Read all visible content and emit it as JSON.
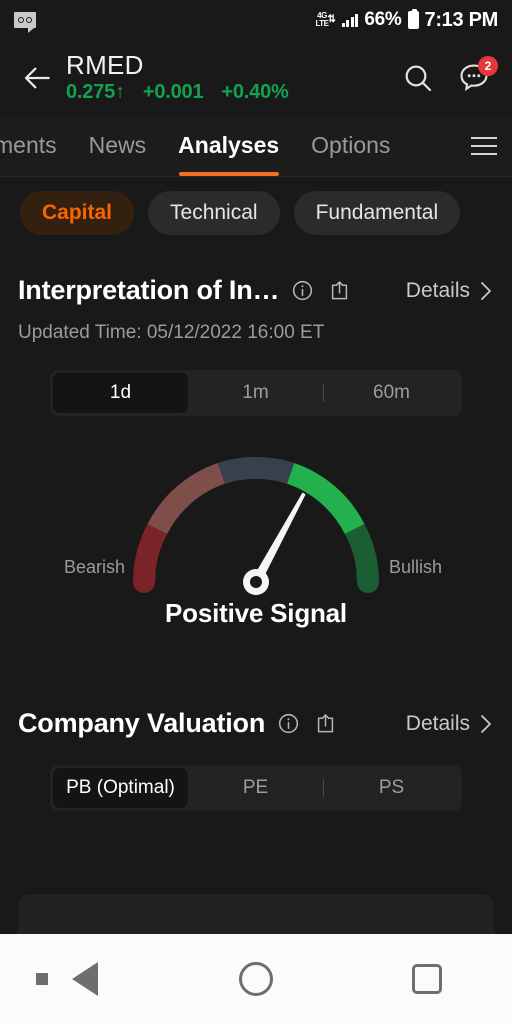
{
  "status_bar": {
    "voicemail_icon": "voicemail-icon",
    "network_label_top": "4G",
    "network_label_bottom": "LTE",
    "network_arrows": "⇅",
    "signal_icon": "signal-bars-icon",
    "battery_percent": "66%",
    "battery_icon": "battery-icon",
    "time": "7:13 PM"
  },
  "header": {
    "back_icon": "back-arrow-icon",
    "symbol": "RMED",
    "price": "0.275",
    "price_arrow": "↑",
    "change": "+0.001",
    "change_percent": "+0.40%",
    "up_color": "#12a150",
    "search_icon": "search-icon",
    "chat_icon": "chat-bubble-icon",
    "chat_badge": "2",
    "badge_color": "#e4393c"
  },
  "nav_tabs": {
    "accent_color": "#f26f21",
    "items": [
      {
        "label": "ments",
        "active": false,
        "clipped": true
      },
      {
        "label": "News",
        "active": false
      },
      {
        "label": "Analyses",
        "active": true
      },
      {
        "label": "Options",
        "active": false
      }
    ],
    "menu_icon": "hamburger-menu-icon"
  },
  "chips": [
    {
      "label": "Capital",
      "active": true
    },
    {
      "label": "Technical",
      "active": false
    },
    {
      "label": "Fundamental",
      "active": false
    }
  ],
  "interpretation": {
    "title": "Interpretation of In…",
    "info_icon": "info-icon",
    "share_icon": "share-icon",
    "details_label": "Details",
    "chevron_icon": "chevron-right-icon",
    "updated": "Updated Time: 05/12/2022 16:00 ET",
    "periods": [
      {
        "label": "1d",
        "active": true
      },
      {
        "label": "1m",
        "active": false
      },
      {
        "label": "60m",
        "active": false
      }
    ]
  },
  "gauge": {
    "left_label": "Bearish",
    "right_label": "Bullish",
    "signal_text": "Positive Signal",
    "needle_angle_deg": 30,
    "segments": [
      {
        "name": "very-bearish",
        "color": "#7a2328"
      },
      {
        "name": "bearish",
        "color": "#7d4e4a"
      },
      {
        "name": "neutral",
        "color": "#383f4d"
      },
      {
        "name": "bullish",
        "color": "#22b14c"
      },
      {
        "name": "very-bullish",
        "color": "#1b5e34"
      }
    ],
    "needle_color": "#f5f5f5"
  },
  "company_valuation": {
    "title": "Company Valuation",
    "info_icon": "info-icon",
    "share_icon": "share-icon",
    "details_label": "Details",
    "chevron_icon": "chevron-right-icon",
    "metrics": [
      {
        "label": "PB (Optimal)",
        "active": true
      },
      {
        "label": "PE",
        "active": false
      },
      {
        "label": "PS",
        "active": false
      }
    ]
  },
  "android_nav": {
    "dot_icon": "menu-dot-icon",
    "back_icon": "nav-back-triangle-icon",
    "home_icon": "nav-home-circle-icon",
    "recents_icon": "nav-recents-square-icon"
  }
}
